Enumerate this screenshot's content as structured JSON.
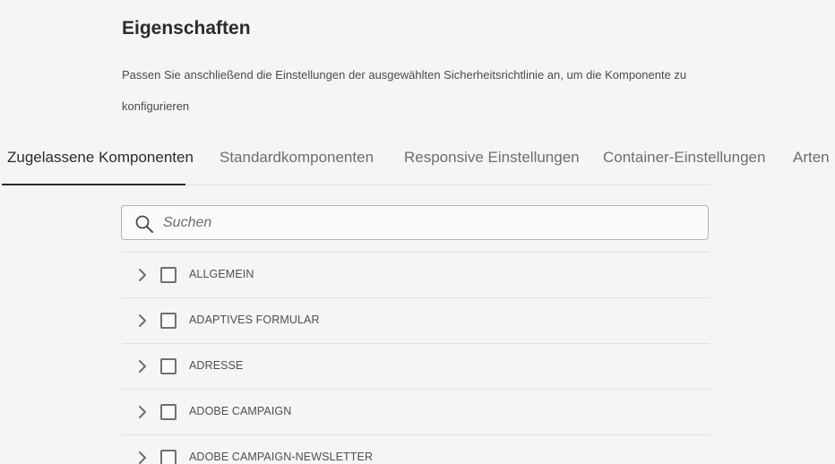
{
  "heading": "Eigenschaften",
  "description": "Passen Sie anschließend die Einstellungen der ausgewählten Sicherheitsrichtlinie an, um die Komponente zu konfigurieren",
  "tabs": [
    {
      "label": "Zugelassene Komponenten",
      "active": true
    },
    {
      "label": "Standardkomponenten",
      "active": false
    },
    {
      "label": "Responsive Einstellungen",
      "active": false
    },
    {
      "label": "Container-Einstellungen",
      "active": false
    },
    {
      "label": "Arten",
      "active": false
    }
  ],
  "search": {
    "placeholder": "Suchen",
    "value": "",
    "icon": "search-icon"
  },
  "component_groups": [
    {
      "label": "ALLGEMEIN",
      "checked": false,
      "expanded": false
    },
    {
      "label": "ADAPTIVES FORMULAR",
      "checked": false,
      "expanded": false
    },
    {
      "label": "ADRESSE",
      "checked": false,
      "expanded": false
    },
    {
      "label": "ADOBE CAMPAIGN",
      "checked": false,
      "expanded": false
    },
    {
      "label": "ADOBE CAMPAIGN-NEWSLETTER",
      "checked": false,
      "expanded": false
    }
  ],
  "colors": {
    "background": "#f5f5f5",
    "text_primary": "#2c2c2c",
    "text_secondary": "#6e6e6e",
    "divider": "#e1e1e1",
    "active_tab_indicator": "#2c2c2c"
  }
}
